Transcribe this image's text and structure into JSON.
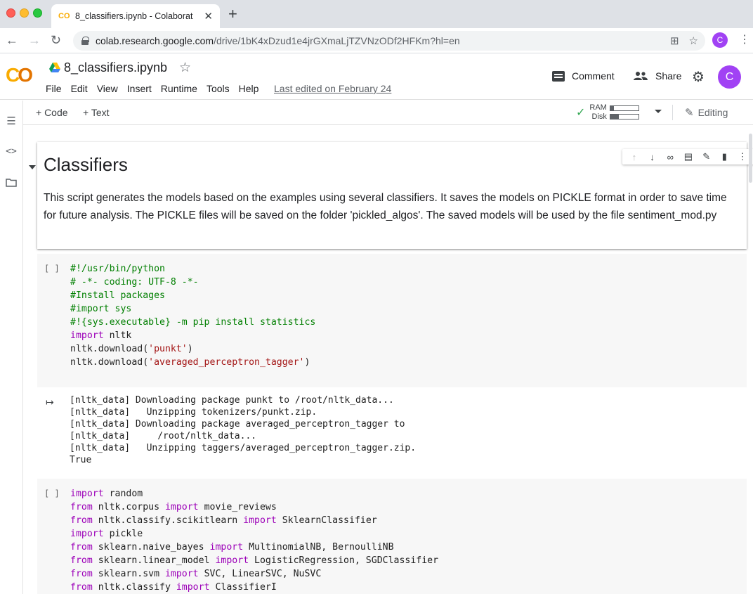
{
  "browser": {
    "tab_title": "8_classifiers.ipynb - Colaborat",
    "tab_close": "✕",
    "new_tab": "+",
    "url_host": "colab.research.google.com",
    "url_path": "/drive/1bK4xDzud1e4jrGXmaLjTZVNzODf2HFKm?hl=en",
    "profile_initial": "C",
    "back": "←",
    "forward": "→",
    "reload": "↻",
    "translate_icon": "⊞",
    "star_icon": "☆",
    "menu_icon": "⋮"
  },
  "colab": {
    "logo_c": "C",
    "logo_o": "O",
    "title": "8_classifiers.ipynb",
    "star": "☆",
    "menu": [
      "File",
      "Edit",
      "View",
      "Insert",
      "Runtime",
      "Tools",
      "Help"
    ],
    "last_edited": "Last edited on February 24",
    "comment_label": "Comment",
    "share_label": "Share",
    "avatar_initial": "C"
  },
  "toolbar": {
    "add_code": "+ Code",
    "add_text": "+ Text",
    "ram_label": "RAM",
    "disk_label": "Disk",
    "ram_fraction": 0.12,
    "disk_fraction": 0.3,
    "editing_label": "Editing"
  },
  "text_cell": {
    "heading": "Classifiers",
    "paragraph": "This script generates the models based on the examples using several classifiers. It saves the models on PICKLE format in order to save time for future analysis. The PICKLE files will be saved on the folder 'pickled_algos'. The saved models will be used by the file sentiment_mod.py"
  },
  "code_cells": [
    {
      "prompt": "[ ]",
      "lines": [
        [
          {
            "t": "#!/usr/bin/python",
            "c": "com"
          }
        ],
        [
          {
            "t": "# -*- coding: UTF-8 -*-",
            "c": "com"
          }
        ],
        [
          {
            "t": "#Install packages",
            "c": "com"
          }
        ],
        [
          {
            "t": "#import sys",
            "c": "com"
          }
        ],
        [
          {
            "t": "#!{sys.executable} -m pip install statistics",
            "c": "com"
          }
        ],
        [
          {
            "t": "import",
            "c": "kw"
          },
          {
            "t": " nltk",
            "c": ""
          }
        ],
        [
          {
            "t": "nltk.download(",
            "c": ""
          },
          {
            "t": "'punkt'",
            "c": "str"
          },
          {
            "t": ")",
            "c": ""
          }
        ],
        [
          {
            "t": "nltk.download(",
            "c": ""
          },
          {
            "t": "'averaged_perceptron_tagger'",
            "c": "str"
          },
          {
            "t": ")",
            "c": ""
          }
        ]
      ]
    },
    {
      "prompt": "[ ]",
      "lines": [
        [
          {
            "t": "import",
            "c": "kw"
          },
          {
            "t": " random",
            "c": ""
          }
        ],
        [
          {
            "t": "from",
            "c": "kw"
          },
          {
            "t": " nltk.corpus ",
            "c": ""
          },
          {
            "t": "import",
            "c": "kw"
          },
          {
            "t": " movie_reviews",
            "c": ""
          }
        ],
        [
          {
            "t": "from",
            "c": "kw"
          },
          {
            "t": " nltk.classify.scikitlearn ",
            "c": ""
          },
          {
            "t": "import",
            "c": "kw"
          },
          {
            "t": " SklearnClassifier",
            "c": ""
          }
        ],
        [
          {
            "t": "import",
            "c": "kw"
          },
          {
            "t": " pickle",
            "c": ""
          }
        ],
        [
          {
            "t": "from",
            "c": "kw"
          },
          {
            "t": " sklearn.naive_bayes ",
            "c": ""
          },
          {
            "t": "import",
            "c": "kw"
          },
          {
            "t": " MultinomialNB, BernoulliNB",
            "c": ""
          }
        ],
        [
          {
            "t": "from",
            "c": "kw"
          },
          {
            "t": " sklearn.linear_model ",
            "c": ""
          },
          {
            "t": "import",
            "c": "kw"
          },
          {
            "t": " LogisticRegression, SGDClassifier",
            "c": ""
          }
        ],
        [
          {
            "t": "from",
            "c": "kw"
          },
          {
            "t": " sklearn.svm ",
            "c": ""
          },
          {
            "t": "import",
            "c": "kw"
          },
          {
            "t": " SVC, LinearSVC, NuSVC",
            "c": ""
          }
        ],
        [
          {
            "t": "from",
            "c": "kw"
          },
          {
            "t": " nltk.classify ",
            "c": ""
          },
          {
            "t": "import",
            "c": "kw"
          },
          {
            "t": " ClassifierI",
            "c": ""
          }
        ]
      ]
    }
  ],
  "output": {
    "text": "[nltk_data] Downloading package punkt to /root/nltk_data...\n[nltk_data]   Unzipping tokenizers/punkt.zip.\n[nltk_data] Downloading package averaged_perceptron_tagger to\n[nltk_data]     /root/nltk_data...\n[nltk_data]   Unzipping taggers/averaged_perceptron_tagger.zip.\nTrue"
  },
  "icons": {
    "tab_favicon": "colab-logo-icon",
    "rail": [
      "table-of-contents-icon",
      "code-snippets-icon",
      "files-icon"
    ],
    "cell_tools": [
      "move-up-icon",
      "move-down-icon",
      "link-icon",
      "comment-icon",
      "edit-icon",
      "delete-icon",
      "more-icon"
    ]
  }
}
